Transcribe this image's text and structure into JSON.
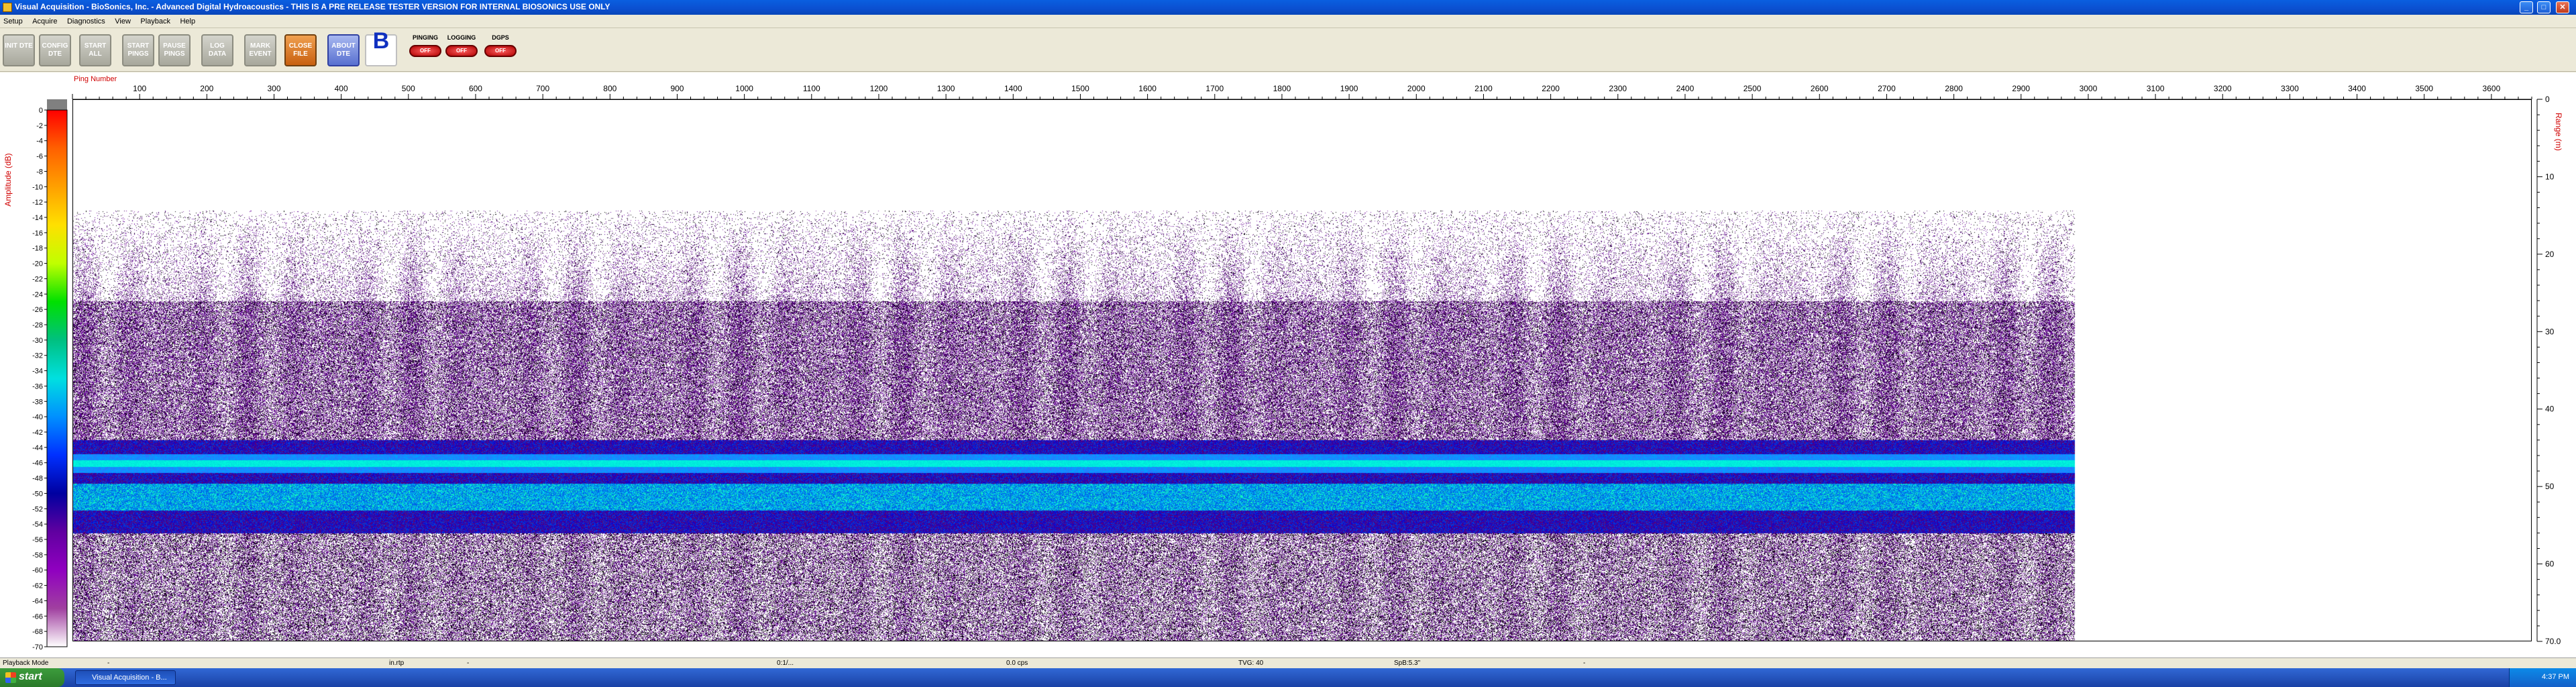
{
  "window": {
    "title": "Visual Acquisition  -  BioSonics, Inc.  -  Advanced Digital Hydroacoustics  -  THIS IS A PRE RELEASE TESTER VERSION FOR INTERNAL BIOSONICS USE ONLY",
    "minimize": "_",
    "maximize": "□",
    "close": "✕"
  },
  "menu": [
    "Setup",
    "Acquire",
    "Diagnostics",
    "View",
    "Playback",
    "Help"
  ],
  "toolbar": {
    "buttons": [
      {
        "name": "init-dte",
        "label": "INIT DTE",
        "style": "gray"
      },
      {
        "name": "config-dte",
        "label": "CONFIG DTE",
        "style": "gray"
      },
      {
        "name": "start-all",
        "label": "START ALL",
        "style": "gray"
      },
      {
        "name": "start-pings",
        "label": "START PINGS",
        "style": "gray"
      },
      {
        "name": "pause-pings",
        "label": "PAUSE PINGS",
        "style": "gray"
      },
      {
        "name": "log-data",
        "label": "LOG DATA",
        "style": "gray"
      },
      {
        "name": "mark-event",
        "label": "MARK EVENT",
        "style": "gray"
      },
      {
        "name": "close-file",
        "label": "CLOSE FILE",
        "style": "orange"
      },
      {
        "name": "about-dte",
        "label": "ABOUT DTE",
        "style": "blue"
      }
    ],
    "logo_icon": "biosonics-logo-icon",
    "logo_glyph": "B",
    "status": [
      {
        "name": "pinging",
        "label": "PINGING",
        "lamp": "OFF"
      },
      {
        "name": "logging",
        "label": "LOGGING",
        "lamp": "OFF"
      },
      {
        "name": "dgps",
        "label": "DGPS",
        "lamp": "OFF"
      }
    ]
  },
  "echogram": {
    "x_axis_label": "Ping Number",
    "x_ticks": [
      "100",
      "200",
      "300",
      "400",
      "500",
      "600",
      "700",
      "800",
      "900",
      "1000",
      "1100",
      "1200",
      "1300",
      "1400",
      "1500",
      "1600",
      "1700",
      "1800",
      "1900",
      "2000",
      "2100",
      "2200",
      "2300",
      "2400",
      "2500",
      "2600",
      "2700",
      "2800",
      "2900",
      "3000",
      "3100",
      "3200",
      "3300",
      "3400",
      "3500",
      "3600"
    ],
    "x_tick_values": [
      100,
      200,
      300,
      400,
      500,
      600,
      700,
      800,
      900,
      1000,
      1100,
      1200,
      1300,
      1400,
      1500,
      1600,
      1700,
      1800,
      1900,
      2000,
      2100,
      2200,
      2300,
      2400,
      2500,
      2600,
      2700,
      2800,
      2900,
      3000,
      3100,
      3200,
      3300,
      3400,
      3500,
      3600
    ],
    "x_range": [
      0,
      3660
    ],
    "data_end_ping": 2980,
    "y_right_label": "Range (m)",
    "y_right_ticks": [
      "0",
      "10",
      "20",
      "30",
      "40",
      "50",
      "60",
      "70.0"
    ],
    "y_right_range": [
      0,
      70
    ],
    "colorbar_label": "Amplitude (dB)",
    "colorbar_ticks": [
      "0",
      "-2",
      "-4",
      "-6",
      "-8",
      "-10",
      "-12",
      "-14",
      "-16",
      "-18",
      "-20",
      "-22",
      "-24",
      "-26",
      "-28",
      "-30",
      "-32",
      "-34",
      "-36",
      "-38",
      "-40",
      "-42",
      "-44",
      "-46",
      "-48",
      "-50",
      "-52",
      "-54",
      "-56",
      "-58",
      "-60",
      "-62",
      "-64",
      "-66",
      "-68",
      "-70"
    ],
    "colorbar_colors": [
      "#808080",
      "#ff0000",
      "#ff6000",
      "#ffa000",
      "#ffe000",
      "#c0ff00",
      "#00e000",
      "#00c080",
      "#00e0e0",
      "#0090ff",
      "#0030ff",
      "#0000a0",
      "#6000a0",
      "#9000c0",
      "#a040a0",
      "#ffffff"
    ],
    "features": {
      "noise_top_m": 18,
      "plankton_top_m": 26,
      "bottom_band_m": [
        44,
        56
      ],
      "bottom_peak_m": 47,
      "deep_scatter_m": [
        56,
        70
      ]
    }
  },
  "status_bar": {
    "mode": "Playback Mode",
    "file": "in.rtp",
    "time": "0:1/...",
    "rate": "0.0 cps",
    "tvg": "TVG: 40",
    "spb": "SpB:5.3\"",
    "dash": "-"
  },
  "taskbar": {
    "start": "start",
    "task_item": "Visual Acquisition - B...",
    "clock": "4:37 PM"
  }
}
